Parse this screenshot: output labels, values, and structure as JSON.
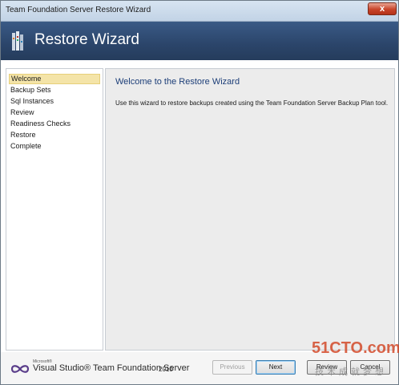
{
  "window": {
    "title": "Team Foundation Server Restore Wizard",
    "close_glyph": "x"
  },
  "banner": {
    "icon": "wizard-icon",
    "title": "Restore Wizard"
  },
  "nav": {
    "items": [
      {
        "label": "Welcome",
        "selected": true
      },
      {
        "label": "Backup Sets",
        "selected": false
      },
      {
        "label": "Sql Instances",
        "selected": false
      },
      {
        "label": "Review",
        "selected": false
      },
      {
        "label": "Readiness Checks",
        "selected": false
      },
      {
        "label": "Restore",
        "selected": false
      },
      {
        "label": "Complete",
        "selected": false
      }
    ]
  },
  "main": {
    "heading": "Welcome to the Restore Wizard",
    "description": "Use this wizard to restore backups created using the Team Foundation Server Backup Plan tool."
  },
  "footer": {
    "logo_icon": "visual-studio-icon",
    "logo_microsoft": "Microsoft®",
    "logo_text": "Visual Studio® Team Foundation Server",
    "logo_year": "2010",
    "buttons": {
      "previous": "Previous",
      "next": "Next",
      "review": "Review",
      "cancel": "Cancel"
    }
  },
  "watermark": {
    "main": "51CTO.com",
    "sub": "技术成就梦想"
  },
  "colors": {
    "banner": "#2b456a",
    "heading": "#1c3e78",
    "nav_selected": "#f4e4a8",
    "watermark": "#d34a2a"
  }
}
